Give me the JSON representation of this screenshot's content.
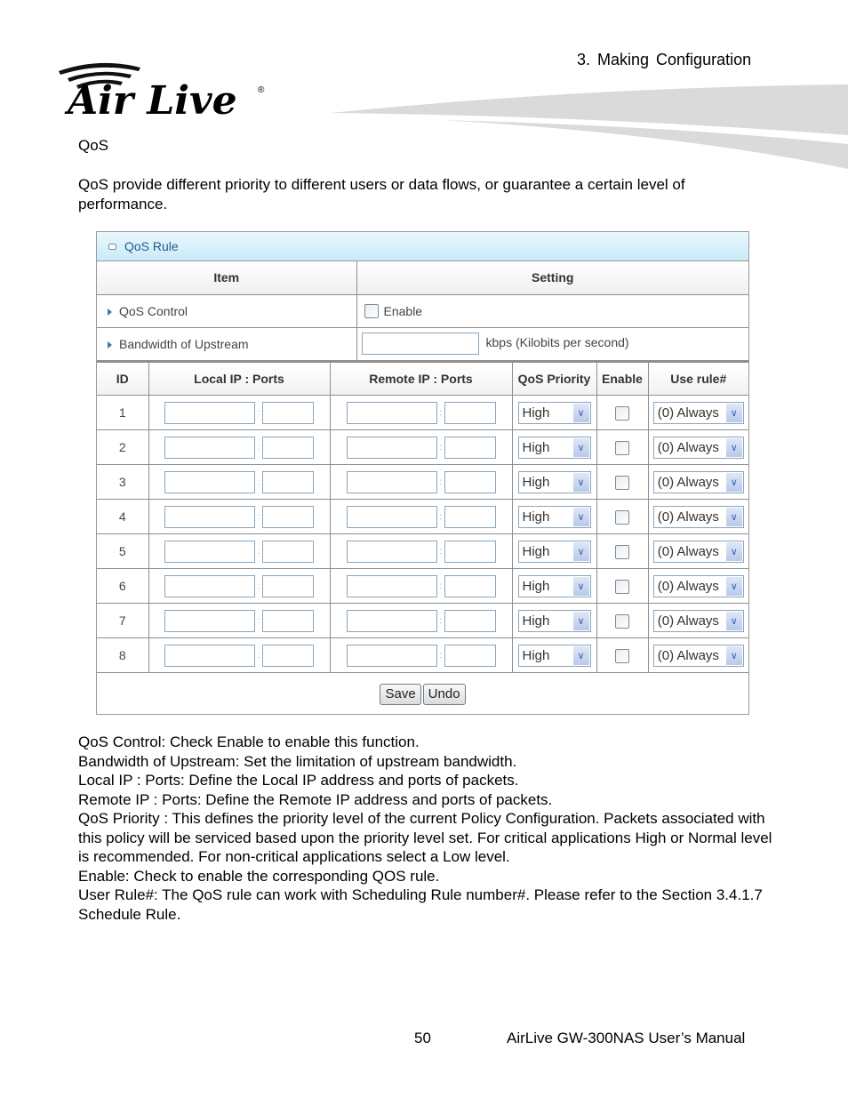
{
  "header": {
    "chapter": "3. Making Configuration",
    "logo_text": "Air Live",
    "logo_mark": "®"
  },
  "section": {
    "title": "QoS",
    "intro": "QoS provide different priority to different users or data flows, or guarantee a certain level of performance."
  },
  "panel": {
    "title": "QoS Rule",
    "col_item": "Item",
    "col_setting": "Setting",
    "qos_control_label": "QoS Control",
    "qos_control_checkbox_label": "Enable",
    "qos_control_checked": false,
    "bandwidth_label": "Bandwidth of Upstream",
    "bandwidth_value": "",
    "bandwidth_unit": "kbps (Kilobits per second)",
    "rules_headers": {
      "id": "ID",
      "local": "Local IP : Ports",
      "remote": "Remote IP : Ports",
      "priority": "QoS Priority",
      "enable": "Enable",
      "use_rule": "Use rule#"
    },
    "separator": ":",
    "rules": [
      {
        "id": "1",
        "local_ip": "",
        "local_port": "",
        "remote_ip": "",
        "remote_port": "",
        "priority": "High",
        "enabled": false,
        "use_rule": "(0) Always"
      },
      {
        "id": "2",
        "local_ip": "",
        "local_port": "",
        "remote_ip": "",
        "remote_port": "",
        "priority": "High",
        "enabled": false,
        "use_rule": "(0) Always"
      },
      {
        "id": "3",
        "local_ip": "",
        "local_port": "",
        "remote_ip": "",
        "remote_port": "",
        "priority": "High",
        "enabled": false,
        "use_rule": "(0) Always"
      },
      {
        "id": "4",
        "local_ip": "",
        "local_port": "",
        "remote_ip": "",
        "remote_port": "",
        "priority": "High",
        "enabled": false,
        "use_rule": "(0) Always"
      },
      {
        "id": "5",
        "local_ip": "",
        "local_port": "",
        "remote_ip": "",
        "remote_port": "",
        "priority": "High",
        "enabled": false,
        "use_rule": "(0) Always"
      },
      {
        "id": "6",
        "local_ip": "",
        "local_port": "",
        "remote_ip": "",
        "remote_port": "",
        "priority": "High",
        "enabled": false,
        "use_rule": "(0) Always"
      },
      {
        "id": "7",
        "local_ip": "",
        "local_port": "",
        "remote_ip": "",
        "remote_port": "",
        "priority": "High",
        "enabled": false,
        "use_rule": "(0) Always"
      },
      {
        "id": "8",
        "local_ip": "",
        "local_port": "",
        "remote_ip": "",
        "remote_port": "",
        "priority": "High",
        "enabled": false,
        "use_rule": "(0) Always"
      }
    ],
    "save_label": "Save",
    "undo_label": "Undo"
  },
  "descriptions": [
    "QoS Control: Check Enable to enable this function.",
    "Bandwidth of Upstream: Set the limitation of upstream bandwidth.",
    "Local IP : Ports: Define the Local IP address and ports of packets.",
    "Remote IP : Ports: Define the Remote IP address and ports of packets.",
    "QoS Priority : This defines the priority level of the current Policy Configuration. Packets associated with this policy will be serviced based upon the priority level set. For critical applications High or Normal level is recommended. For non-critical applications select a Low level.",
    "Enable: Check to enable the corresponding QOS rule.",
    "User Rule#: The QoS rule can work with Scheduling Rule number#. Please refer to the Section 3.4.1.7 Schedule Rule."
  ],
  "footer": {
    "page_number": "50",
    "manual_title": "AirLive GW-300NAS User’s Manual"
  }
}
